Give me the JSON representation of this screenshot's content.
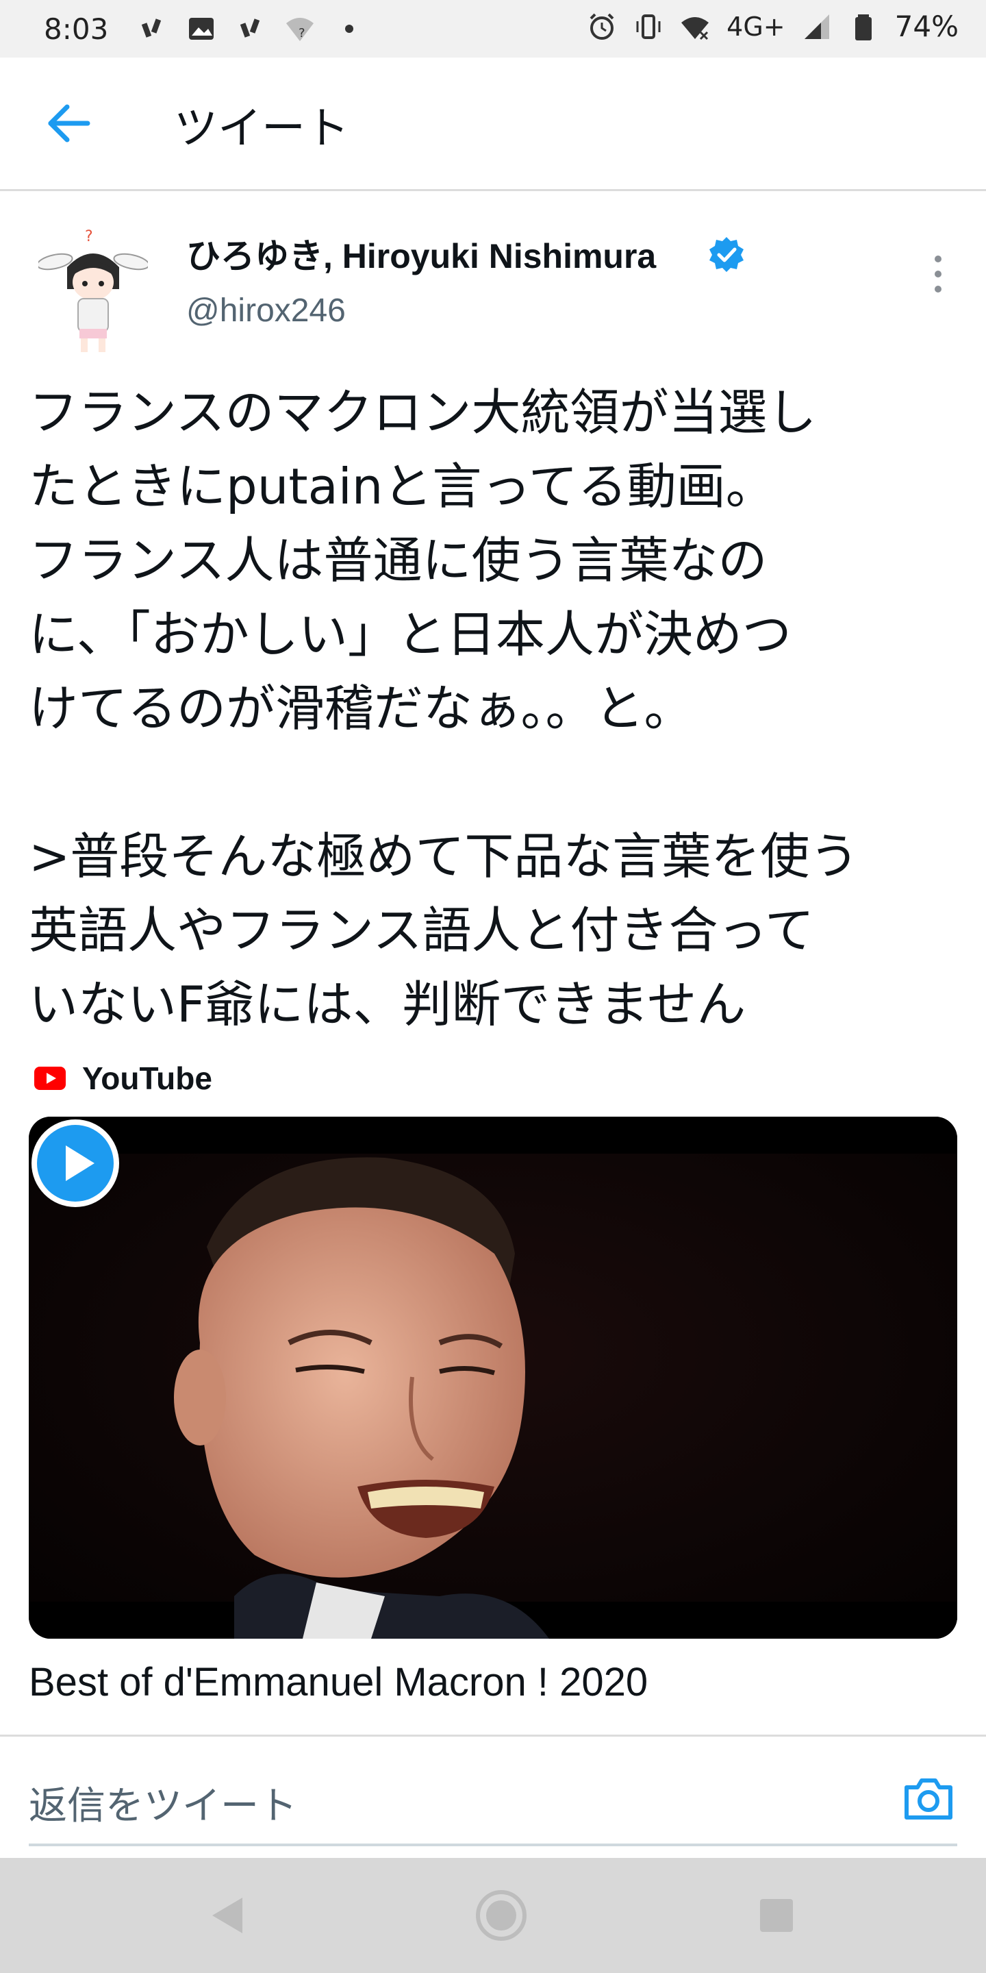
{
  "status_bar": {
    "time": "8:03",
    "network": "4G+",
    "battery": "74%",
    "icons": [
      "notification-icon",
      "photo-icon",
      "notification-icon",
      "wifi-question-icon",
      "dot-icon",
      "alarm-icon",
      "vibrate-icon",
      "wifi-icon",
      "signal-icon",
      "battery-icon"
    ]
  },
  "app_bar": {
    "title": "ツイート",
    "back_icon": "arrow-left-icon",
    "accent": "#1d9bf0"
  },
  "author": {
    "name": "ひろゆき, Hiroyuki Nishimura",
    "handle": "@hirox246",
    "verified": true,
    "verified_color": "#1d9bf0"
  },
  "tweet": {
    "text": "フランスのマクロン大統領が当選し\nたときにputainと言ってる動画。\nフランス人は普通に使う言葉なの\nに、「おかしい」と日本人が決めつ\nけてるのが滑稽だなぁ。。と。\n\n>普段そんな極めて下品な言葉を使う\n英語人やフランス語人と付き合って\nいないF爺には、判断できません"
  },
  "link_card": {
    "source": "YouTube",
    "source_color": "#ff0000",
    "title": "Best of d'Emmanuel Macron ! 2020",
    "play_color": "#1d9bf0"
  },
  "reply": {
    "placeholder": "返信をツイート",
    "camera_icon": "camera-icon"
  },
  "nav_bar": {
    "icons": [
      "nav-back-icon",
      "nav-home-icon",
      "nav-recent-icon"
    ]
  }
}
